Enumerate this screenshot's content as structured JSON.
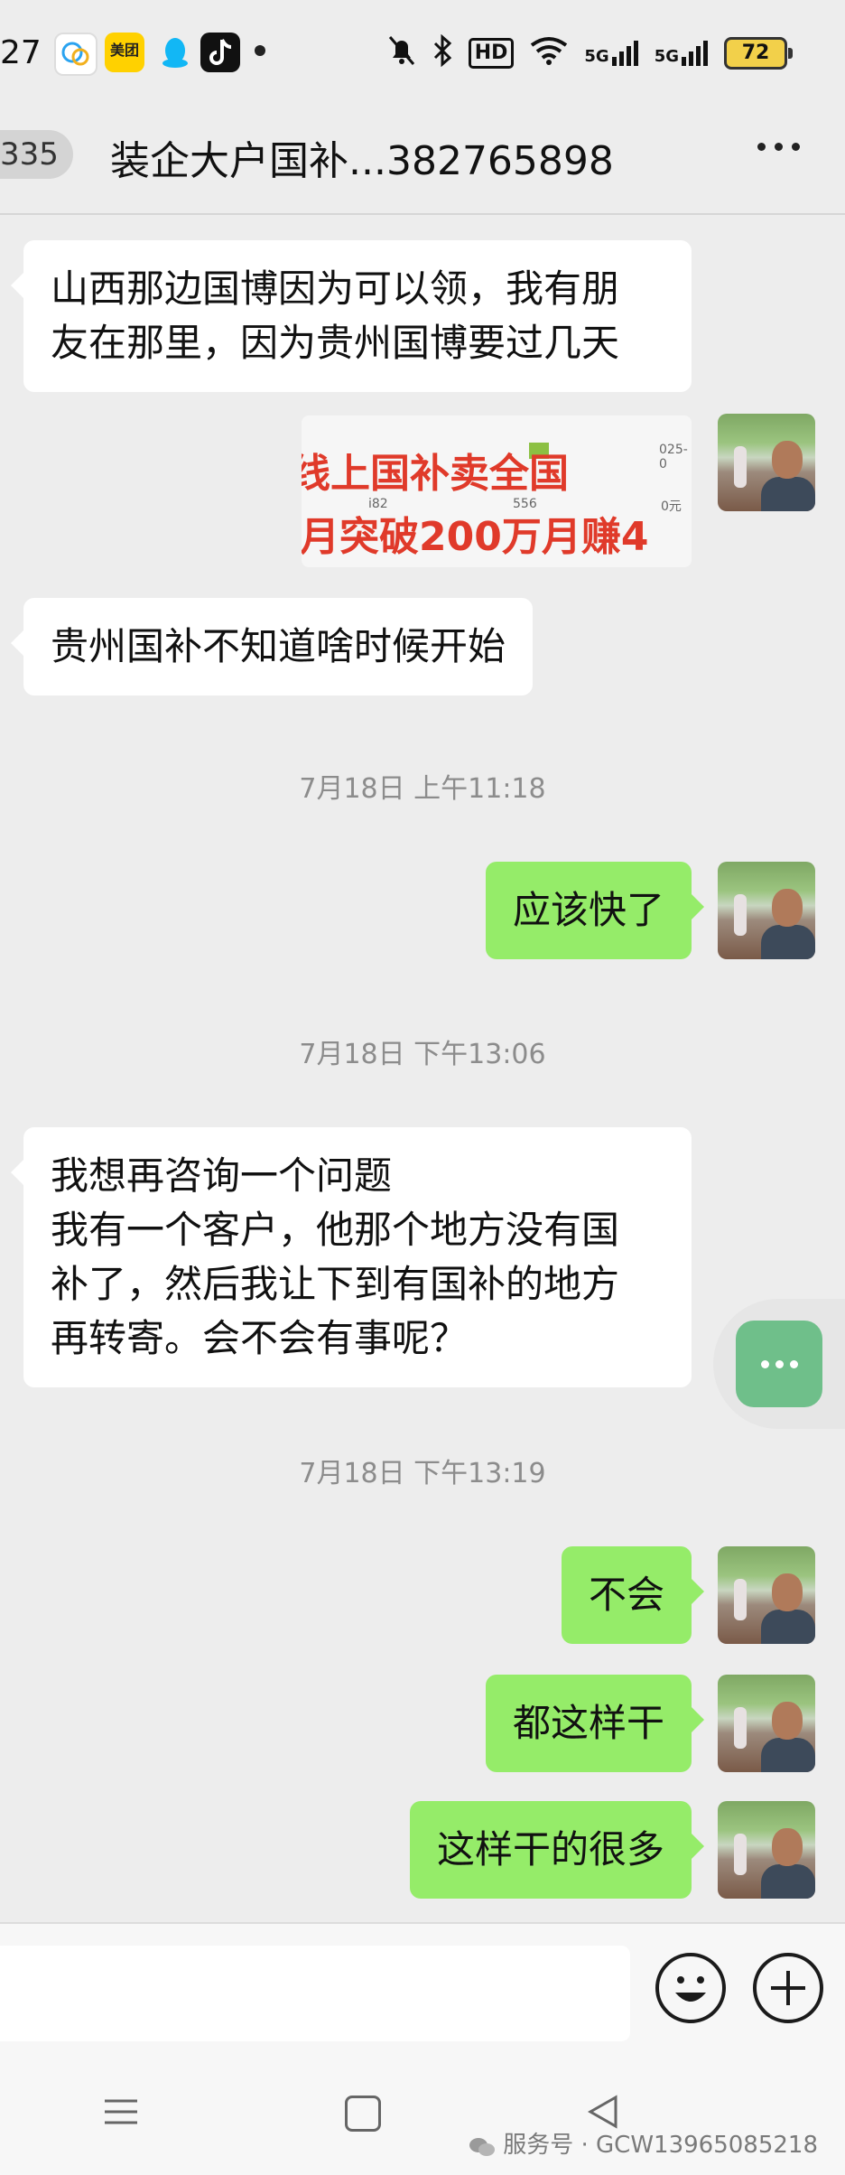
{
  "status_bar": {
    "time": "27",
    "app_badge_1": "美团",
    "battery": "72",
    "hd_label": "HD",
    "net_1": "5G",
    "net_2": "5G"
  },
  "header": {
    "unread_count": "335",
    "title": "装企大户国补...382765898"
  },
  "messages": [
    {
      "type": "text",
      "side": "in",
      "text": "山西那边国博因为可以领，我有朋\n友在那里，因为贵州国博要过几天"
    },
    {
      "type": "image",
      "side": "out",
      "line1": "线上国补卖全国",
      "line2": "月突破200万月赚4",
      "small_1": "025-0",
      "small_2": "i82",
      "small_3": "556",
      "small_4": "0元"
    },
    {
      "type": "text",
      "side": "in",
      "text": "贵州国补不知道啥时候开始"
    },
    {
      "type": "time",
      "text": "7月18日 上午11:18"
    },
    {
      "type": "text",
      "side": "out",
      "text": "应该快了"
    },
    {
      "type": "time",
      "text": "7月18日 下午13:06"
    },
    {
      "type": "text",
      "side": "in",
      "text": "我想再咨询一个问题\n我有一个客户，他那个地方没有国\n补了，然后我让下到有国补的地方\n再转寄。会不会有事呢？"
    },
    {
      "type": "time",
      "text": "7月18日 下午13:19"
    },
    {
      "type": "text",
      "side": "out",
      "text": "不会"
    },
    {
      "type": "text",
      "side": "out",
      "text": "都这样干"
    },
    {
      "type": "text",
      "side": "out",
      "text": "这样干的很多"
    }
  ],
  "watermark": "服务号 · GCW13965085218",
  "icons": [
    "wechat-icon",
    "meituan-icon",
    "qq-icon",
    "tiktok-icon",
    "mute-icon",
    "bluetooth-icon",
    "wifi-icon",
    "more-icon",
    "emoji-icon",
    "plus-icon",
    "menu-icon",
    "home-icon",
    "back-icon"
  ],
  "colors": {
    "outgoing_bubble": "#95ec69",
    "incoming_bubble": "#ffffff",
    "background": "#ededed"
  }
}
